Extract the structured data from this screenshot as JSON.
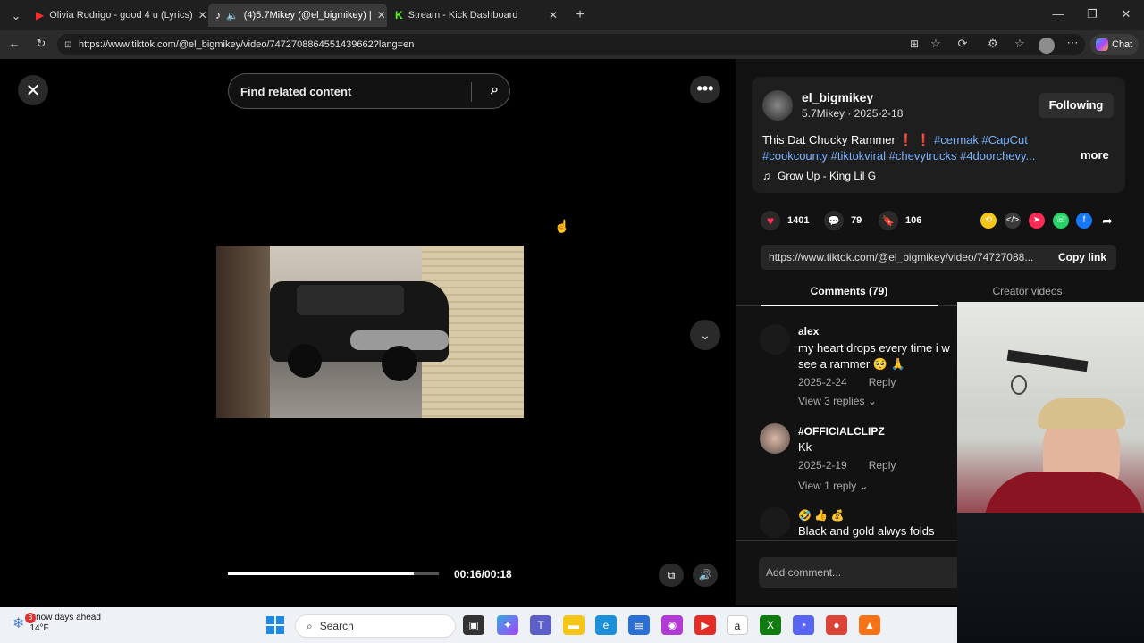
{
  "browser": {
    "tabs": [
      {
        "title": "Olivia Rodrigo - good 4 u (Lyrics)",
        "icon": "youtube-icon",
        "active": false
      },
      {
        "title": "(4)5.7Mikey (@el_bigmikey) |",
        "icon": "tiktok-icon",
        "active": true
      },
      {
        "title": "Stream - Kick Dashboard",
        "icon": "kick-icon",
        "active": false
      }
    ],
    "url": "https://www.tiktok.com/@el_bigmikey/video/7472708864551439662?lang=en",
    "chat_label": "Chat"
  },
  "video": {
    "search_placeholder": "Find related content",
    "time": "00:16/00:18",
    "progress": 0.88
  },
  "post": {
    "username": "el_bigmikey",
    "display_line": "5.7Mikey · 2025-2-18",
    "follow_label": "Following",
    "caption_text": "This Dat Chucky Rammer",
    "hashtags_line1": "#cermak #CapCut",
    "hashtags_line2": "#cookcounty #tiktokviral #chevytrucks #4doorchevy...",
    "more_label": "more",
    "music": "Grow Up - King Lil G",
    "likes": "1401",
    "comments": "79",
    "saves": "106",
    "link": "https://www.tiktok.com/@el_bigmikey/video/74727088...",
    "copy_label": "Copy link"
  },
  "tabs": {
    "comments_label": "Comments (79)",
    "creator_label": "Creator videos"
  },
  "comments": [
    {
      "name": "alex",
      "text": "my heart drops every time i w see a rammer 🥺 🙏",
      "date": "2025-2-24",
      "reply": "Reply",
      "replies": "View 3 replies"
    },
    {
      "name": "#OFFICIALCLIPZ",
      "text": "Kk",
      "date": "2025-2-19",
      "reply": "Reply",
      "replies": "View 1 reply"
    },
    {
      "name": "🤣 👍 💰",
      "text": "Black and gold alwys folds",
      "date": "",
      "reply": "",
      "replies": ""
    }
  ],
  "add_comment_placeholder": "Add comment...",
  "taskbar": {
    "weather_title": "Snow days ahead",
    "weather_temp": "14°F",
    "weather_badge": "3",
    "search_label": "Search"
  },
  "colors": {
    "like": "#fe2c55",
    "hashtag": "#7ab4ff",
    "panel_bg": "#121212"
  }
}
